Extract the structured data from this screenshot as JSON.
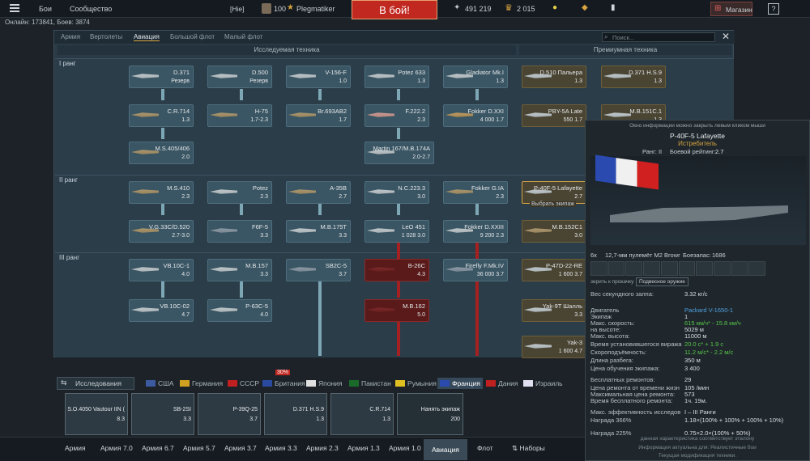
{
  "topbar": {
    "menu_icon": "menu-icon",
    "nav": [
      "Бои",
      "Сообщество"
    ],
    "squad_tag": "[Hie]",
    "level": "100",
    "username": "Plegmatiker",
    "battle_button": "В бой!",
    "silver": "491 219",
    "gold": "2 015",
    "shop": "Магазин",
    "help": "?"
  },
  "online_text": "Онлайн: 173841, Боев: 3874",
  "tree": {
    "tabs": [
      "Армия",
      "Вертолеты",
      "Авиация",
      "Большой флот",
      "Малый флот"
    ],
    "active_tab": "Авиация",
    "search_placeholder": "Поиск...",
    "sections": [
      "Исследуемая техника",
      "Премиумная техника"
    ],
    "ranks": [
      "I ранг",
      "II ранг",
      "III ранг"
    ],
    "cards": [
      {
        "name": "D.371",
        "br": "Резерв"
      },
      {
        "name": "D.500",
        "br": "Резерв"
      },
      {
        "name": "V-156-F",
        "br": "1.0"
      },
      {
        "name": "Potez 633",
        "br": "1.3"
      },
      {
        "name": "Gladiator Mk.I",
        "br": "1.3"
      },
      {
        "name": "D.510 Пальера",
        "br": "1.3"
      },
      {
        "name": "D.371 H.S.9",
        "br": "1.3"
      },
      {
        "name": "C.R.714",
        "br": "1.3"
      },
      {
        "name": "H-75",
        "br": "1.7-2.3"
      },
      {
        "name": "Br.693AB2",
        "br": "1.7"
      },
      {
        "name": "F.222.2",
        "br": "2.3"
      },
      {
        "name": "Fokker D.XXI",
        "br": "4 000 1.7"
      },
      {
        "name": "PBY-5A Late",
        "br": "550 1.7"
      },
      {
        "name": "M.B.151C.1",
        "br": "1.3"
      },
      {
        "name": "M.S.405/406",
        "br": "2.0"
      },
      {
        "name": "Martin 167/M.B.174A",
        "br": "2.0-2.7"
      },
      {
        "name": "M.S.410",
        "br": "2.3"
      },
      {
        "name": "Potez",
        "br": "2.3"
      },
      {
        "name": "A-35B",
        "br": "2.7"
      },
      {
        "name": "N.C.223.3",
        "br": "3.0"
      },
      {
        "name": "Fokker G.IA",
        "br": "2.3"
      },
      {
        "name": "P-40F-5 Lafayette",
        "br": "2.7"
      },
      {
        "name": "V.G.33C/D.520",
        "br": "2.7-3.0"
      },
      {
        "name": "F6F-5",
        "br": "3.3"
      },
      {
        "name": "M.B.175T",
        "br": "3.3"
      },
      {
        "name": "LeO 451",
        "br": "1 028 3.0"
      },
      {
        "name": "Fokker D.XXIII",
        "br": "9 200 2.3"
      },
      {
        "name": "M.B.152C1",
        "br": "3.0"
      },
      {
        "name": "VB.10C-1",
        "br": "4.0"
      },
      {
        "name": "M.B.157",
        "br": "3.3"
      },
      {
        "name": "SB2C-5",
        "br": "3.7"
      },
      {
        "name": "B-26C",
        "br": "4.3"
      },
      {
        "name": "Firefly F.Mk.IV",
        "br": "36 000 3.7"
      },
      {
        "name": "P-47D-22-RE",
        "br": "1 600 3.7"
      },
      {
        "name": "VB.10C-02",
        "br": "4.7"
      },
      {
        "name": "P-63C-5",
        "br": "4.0"
      },
      {
        "name": "M.B.162",
        "br": "5.0"
      },
      {
        "name": "Yak-9T Шалль",
        "br": "3.3"
      },
      {
        "name": "Yak-3",
        "br": "1 600 4.7"
      }
    ],
    "crew_hint": "Выбрать экипаж"
  },
  "nations": {
    "research_label": "Исследования",
    "badge_30": "30%",
    "list": [
      {
        "name": "США",
        "color": "#3c5aa0"
      },
      {
        "name": "Германия",
        "color": "#d0a020"
      },
      {
        "name": "СССР",
        "color": "#c02020"
      },
      {
        "name": "Британия",
        "color": "#2a4aa0"
      },
      {
        "name": "Япония",
        "color": "#e0e0e0"
      },
      {
        "name": "Пакистан",
        "color": "#1a6a2a"
      },
      {
        "name": "Румыния",
        "color": "#e0c020"
      },
      {
        "name": "Франция",
        "color": "#2a4ab0"
      },
      {
        "name": "Дания",
        "color": "#c02020"
      },
      {
        "name": "Израиль",
        "color": "#e0e0f0"
      }
    ],
    "active": "Франция"
  },
  "crew_slots": [
    {
      "name": "S.O.4050 Vautour IIN (",
      "br": "8.3"
    },
    {
      "name": "SB-2SI",
      "br": "3.3"
    },
    {
      "name": "P-39Q-25",
      "br": "3.7"
    },
    {
      "name": "D.371 H.S.9",
      "br": "1.3"
    },
    {
      "name": "C.R.714",
      "br": "1.3"
    },
    {
      "name": "Нанять экипаж",
      "br": "200"
    }
  ],
  "bottom_tabs": [
    "Армия",
    "Армия 7.0",
    "Армия 6.7",
    "Армия 5.7",
    "Армия 3.7",
    "Армия 3.3",
    "Армия 2.3",
    "Армия 1.3",
    "Армия 1.0",
    "Авиация",
    "Флот",
    "Наборы"
  ],
  "active_bottom_tab": "Авиация",
  "tooltip": {
    "hint": "Окно информации можно закрыть левым кликом мыши",
    "vehicle": "P-40F-5 Lafayette",
    "class": "Истребитель",
    "rank": "Ранг: II",
    "combat_rating_label": "Боевой рейтинг:",
    "combat_rating": "2.7",
    "weapon_count": "6x",
    "weapon": "12,7-мм пулемёт M2 Browr",
    "ammo_label": "Боезапас:",
    "ammo": "1686",
    "button_labels": [
      "зерить к прокачку",
      "Подвесное оружие"
    ],
    "stats": [
      {
        "k": "Вес секундного залпа:",
        "v": "3.32 кг/с"
      },
      {
        "k": "Двигатель",
        "v": "Packard V-1650-1"
      },
      {
        "k": "Экипаж",
        "v": "1"
      },
      {
        "k": "Макс. скорость:",
        "v": "615 км/ч* - 15.8 км/ч"
      },
      {
        "k": "на высоте:",
        "v": "5029 м"
      },
      {
        "k": "Макс. высота:",
        "v": "11000 м"
      },
      {
        "k": "Время установившегося виража",
        "v": "20.0 с* + 1.9 с"
      },
      {
        "k": "Скороподъёмность:",
        "v": "11.2 м/с* - 2.2 м/с"
      },
      {
        "k": "Длина разбега:",
        "v": "350 м"
      },
      {
        "k": "Цена обучения экипажа:",
        "v": "3 400"
      },
      {
        "k": "Бесплатных ремонтов:",
        "v": "29"
      },
      {
        "k": "Цена ремонта от времени жизн",
        "v": "105 /мин"
      },
      {
        "k": "Максимальная цена ремонта:",
        "v": "573"
      },
      {
        "k": "Время бесплатного ремонта:",
        "v": "1ч. 19м."
      },
      {
        "k": "Макс. эффективность исследов",
        "v": "I – III Ранги"
      },
      {
        "k": "Награда 366%",
        "v": "1.18×(100% + 100% + 100% + 10%)"
      },
      {
        "k": "Награда 225%",
        "v": "0.75×2.0×(100% + 50%)"
      }
    ],
    "footer": [
      "данная характеристика соответствует эталону",
      "Информация актуальна для: Реалистичные бои",
      "Текущая модификация техники."
    ]
  },
  "colors": {
    "accent": "#d7a341",
    "battle": "#c02820",
    "premium": "#4a4433",
    "research": "#3a5563",
    "red_line": "#a52020"
  }
}
